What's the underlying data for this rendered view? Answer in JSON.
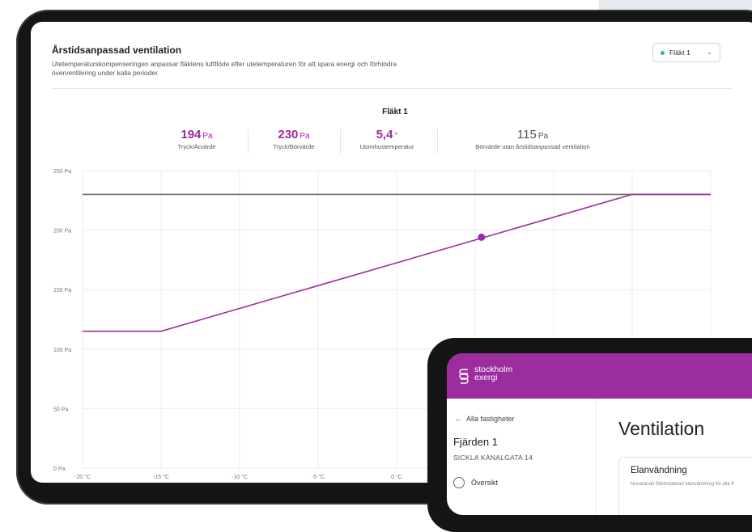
{
  "card": {
    "title": "Årstidsanpassad ventilation",
    "description": "Utetemperaturskompenseringen anpassar fläktens luftflöde efter utetemperaturen för att spara energi och förhindra överventilering under kalla perioder.",
    "fan_selector": {
      "selected": "Fläkt 1"
    }
  },
  "stats": [
    {
      "value": "194",
      "unit": "Pa",
      "label": "Tryck/Ärvärde"
    },
    {
      "value": "230",
      "unit": "Pa",
      "label": "Tryck/Börvärde"
    },
    {
      "value": "5,4",
      "unit": "°",
      "label": "Utomhustemperatur"
    },
    {
      "value": "115",
      "unit": "Pa",
      "label": "Börvärde utan årstidsanpassad ventilation"
    }
  ],
  "chart_data": {
    "type": "line",
    "title": "Fläkt 1",
    "y_ticks": [
      "250 Pa",
      "200 Pa",
      "150 Pa",
      "100 Pa",
      "50 Pa",
      "0 Pa"
    ],
    "x_ticks": [
      "-20 °C",
      "-15 °C",
      "-10 °C",
      "-5 °C",
      "0 °C"
    ],
    "ylim": [
      0,
      250
    ],
    "xlim": [
      -20,
      20
    ],
    "grid": true,
    "series": [
      {
        "color": "#9c2d9f",
        "points": [
          [
            -20,
            115
          ],
          [
            -15,
            115
          ],
          [
            15,
            230
          ],
          [
            20,
            230
          ]
        ]
      },
      {
        "color": "#6b6b6b",
        "points": [
          [
            -20,
            230
          ],
          [
            20,
            230
          ]
        ]
      }
    ],
    "marker": {
      "x": 5.4,
      "y": 194,
      "color": "#9c2d9f"
    }
  },
  "phone": {
    "brand_line1": "stockholm",
    "brand_line2": "exergi",
    "back_link": "Alla fastigheter",
    "property_name": "Fjärden 1",
    "property_address": "SICKLA KANALGATA 14",
    "nav_overview": "Översikt",
    "page_heading": "Ventilation",
    "card_title": "Elanvändning",
    "card_desc": "Nuvarande fläktrelaterad elanvändning för alla fl"
  },
  "colors": {
    "brand_purple": "#9c2d9f",
    "status_green": "#2fbf71",
    "reference_line": "#6b6b6b"
  },
  "icons": [
    "status-dot-icon",
    "chevron-down-icon",
    "arrow-left-icon",
    "stockholm-exergi-logo-icon",
    "overview-icon"
  ]
}
